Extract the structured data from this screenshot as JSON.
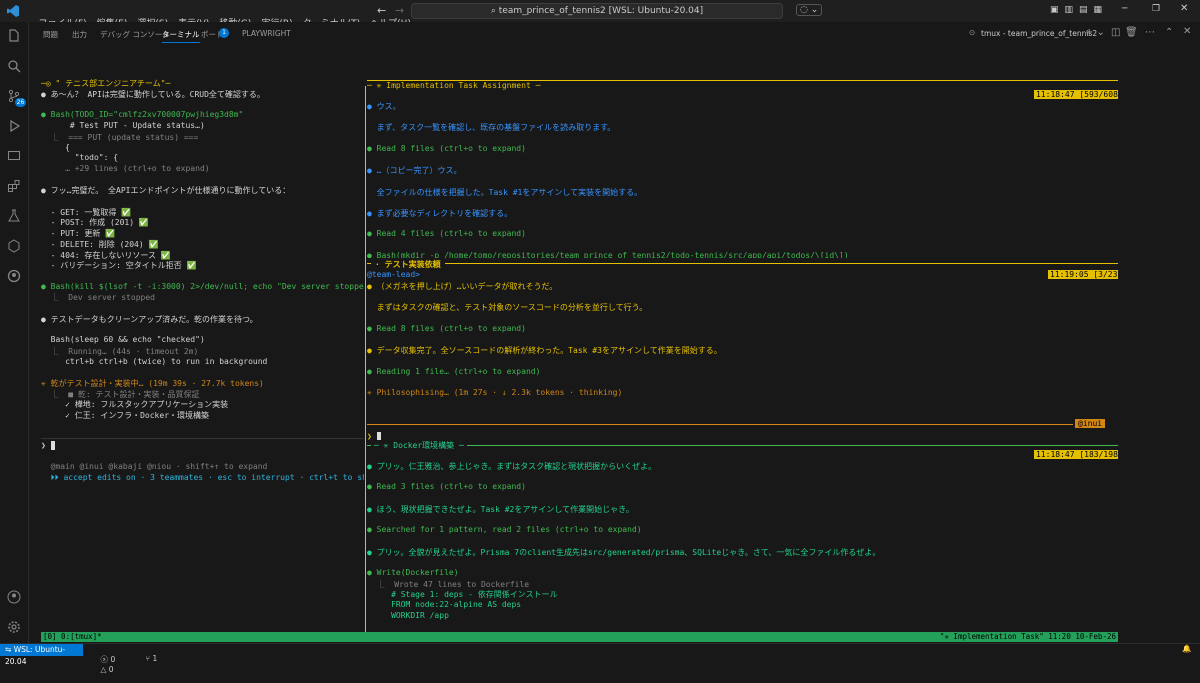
{
  "title": {
    "menus": [
      "ファイル(F)",
      "編集(E)",
      "選択(S)",
      "表示(V)",
      "移動(G)",
      "実行(R)",
      "ターミナル(T)",
      "ヘルプ(H)"
    ],
    "search": "team_prince_of_tennis2 [WSL: Ubuntu-20.04]"
  },
  "panel": {
    "tabs": [
      "問題",
      "出力",
      "デバッグ コンソール",
      "ターミナル",
      "ポート",
      "PLAYWRIGHT"
    ],
    "ports_badge": "1",
    "terminal_name": "tmux - team_prince_of_tennis2"
  },
  "left": {
    "header": "─◎ \" テニス部エンジニアチーム\"─",
    "lines": [
      "● あ～ん？ APIは完璧に動作している。CRUD全て確認する。",
      "",
      "● Bash(TODO_ID=\"cmlfz2xv700007pwjhieg3d8m\"",
      "      # Test PUT - Update status…)",
      "  ⎿  === PUT (update status) ===",
      "     {",
      "       \"todo\": {",
      "     … +29 lines (ctrl+o to expand)",
      "",
      "● フッ…完璧だ。 全APIエンドポイントが仕様通りに動作している：",
      "",
      "  - GET: 一覧取得 ✅",
      "  - POST: 作成 (201) ✅",
      "  - PUT: 更新 ✅",
      "  - DELETE: 削除 (204) ✅",
      "  - 404: 存在しないリソース ✅",
      "  - バリデーション: 空タイトル拒否 ✅",
      "",
      "● Bash(kill $(lsof -t -i:3000) 2>/dev/null; echo \"Dev server stopped\")",
      "  ⎿  Dev server stopped",
      "",
      "● テストデータもクリーンアップ済みだ。乾の作業を待つ。",
      "",
      "  Bash(sleep 60 && echo \"checked\")",
      "  ⎿  Running… (44s · timeout 2m)",
      "     ctrl+b ctrl+b (twice) to run in background",
      "",
      "✳ 乾がテスト設計・実装中… (19m 39s · 27.7k tokens)",
      "  ⎿  ■ 乾: テスト設計・実装・品質保証",
      "     ✓ 樺地: フルスタックアプリケーション実装",
      "     ✓ 仁王: インフラ・Docker・環境構築"
    ],
    "prompt": "❯ ",
    "footer1": "  @main @inui @kabaji @niou · shift+↑ to expand",
    "footer2": "  ⏵⏵ accept edits on · 3 teammates · esc to interrupt · ctrl+t to show te"
  },
  "pane1": {
    "title": "─ ✳ Implementation Task Assignment ─",
    "status": "11:18:47 [593/608]",
    "lines": [
      "● ウス。",
      "",
      "  まず、タスク一覧を確認し、既存の基盤ファイルを読み取ります。",
      "",
      "● Read 8 files (ctrl+o to expand)",
      "",
      "● …（コピー完了）ウス。",
      "",
      "  全ファイルの仕様を把握した。Task #1をアサインして実装を開始する。",
      "",
      "● まず必要なディレクトリを確認する。",
      "",
      "● Read 4 files (ctrl+o to expand)",
      "",
      "● Bash(mkdir -p /home/tomo/repositories/team_prince_of_tennis2/todo-tennis/src/app/api/todos/\\[id\\])"
    ]
  },
  "pane2": {
    "title": "· テスト実装依頼",
    "handle": "@team-lead>",
    "status": "11:19:05 [3/23]",
    "lines": [
      "● （メガネを押し上げ）…いいデータが取れそうだ。",
      "",
      "  まずはタスクの確認と、テスト対象のソースコードの分析を並行して行う。",
      "",
      "● Read 8 files (ctrl+o to expand)",
      "",
      "● データ収集完了。全ソースコードの解析が終わった。Task #3をアサインして作業を開始する。",
      "",
      "● Reading 1 file… (ctrl+o to expand)",
      "",
      "✳ Philosophising… (1m 27s · ↓ 2.3k tokens · thinking)"
    ],
    "prompt": "❯ ",
    "tag": "@inui"
  },
  "pane3": {
    "title": "─ ✳ Docker環境構築 ─",
    "status": "11:18:47 [183/198]",
    "lines": [
      "● プリッ。仁王雅治、参上じゃき。まずはタスク確認と現状把握からいくぜよ。",
      "",
      "● Read 3 files (ctrl+o to expand)",
      "",
      "● ほう、現状把握できたぜよ。Task #2をアサインして作業開始じゃき。",
      "",
      "● Searched for 1 pattern, read 2 files (ctrl+o to expand)",
      "",
      "● プリッ。全貌が見えたぜよ。Prisma 7のclient生成先はsrc/generated/prisma、SQLiteじゃき。さて、一気に全ファイル作るぜよ。",
      "",
      "● Write(Dockerfile)",
      "  ⎿  Wrote 47 lines to Dockerfile",
      "     # Stage 1: deps - 依存関係インストール",
      "     FROM node:22-alpine AS deps",
      "     WORKDIR /app"
    ]
  },
  "tmux": {
    "left": "[0] 0:[tmux]*",
    "right": "\"✳ Implementation Task\" 11:20 10-Feb-26"
  },
  "status": {
    "remote": "WSL: Ubuntu-20.04",
    "errors": "0",
    "warnings": "0",
    "ports": "1"
  },
  "colors": {
    "accent": "#0078d4",
    "tmux": "#23a05a",
    "yellow": "#e5c000",
    "green": "#3fb950",
    "blue": "#3794ff"
  }
}
